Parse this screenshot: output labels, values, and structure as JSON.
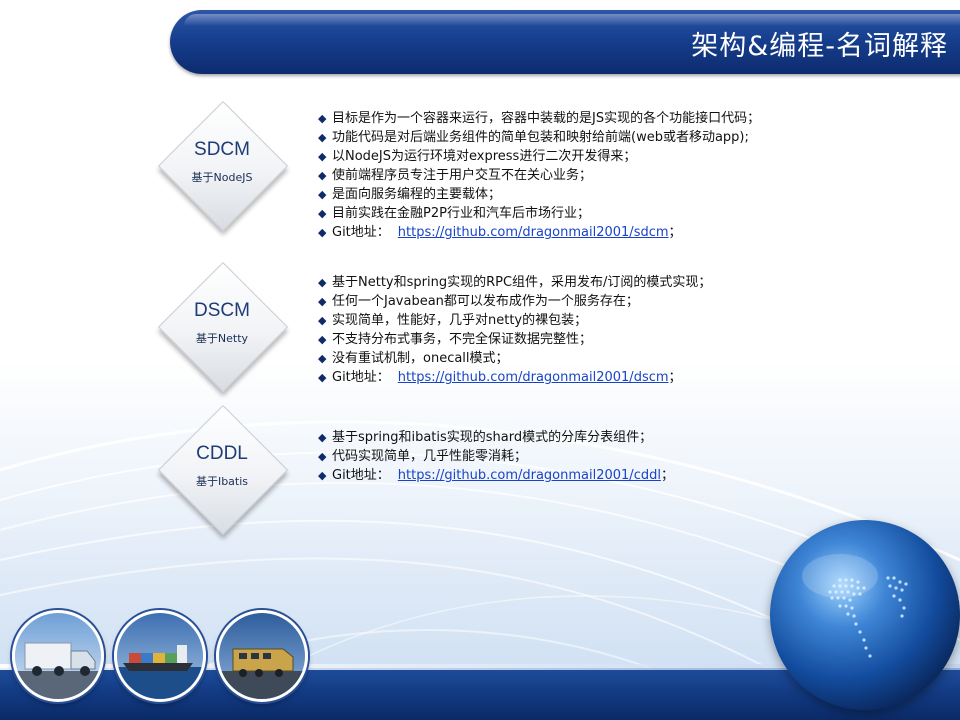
{
  "title": "架构&编程-名词解释",
  "sections": [
    {
      "name": "SDCM",
      "sub": "基于NodeJS",
      "bullets": [
        "目标是作为一个容器来运行，容器中装载的是JS实现的各个功能接口代码；",
        "功能代码是对后端业务组件的简单包装和映射给前端(web或者移动app);",
        "以NodeJS为运行环境对express进行二次开发得来；",
        "使前端程序员专注于用户交互不在关心业务；",
        "是面向服务编程的主要载体；",
        "目前实践在金融P2P行业和汽车后市场行业；"
      ],
      "git_label": "Git地址：",
      "git_url": "https://github.com/dragonmail2001/sdcm",
      "git_suffix": "；"
    },
    {
      "name": "DSCM",
      "sub": "基于Netty",
      "bullets": [
        "基于Netty和spring实现的RPC组件，采用发布/订阅的模式实现；",
        "任何一个Javabean都可以发布成作为一个服务存在；",
        "实现简单，性能好，几乎对netty的裸包装；",
        "不支持分布式事务，不完全保证数据完整性；",
        "没有重试机制，onecall模式；"
      ],
      "git_label": "Git地址：",
      "git_url": "https://github.com/dragonmail2001/dscm",
      "git_suffix": "；"
    },
    {
      "name": "CDDL",
      "sub": "基于Ibatis",
      "bullets": [
        "基于spring和ibatis实现的shard模式的分库分表组件；",
        "代码实现简单，几乎性能零消耗；"
      ],
      "git_label": "Git地址：",
      "git_url": "https://github.com/dragonmail2001/cddl",
      "git_suffix": "；"
    }
  ],
  "bullet_glyph": "◆",
  "colors": {
    "title_bar": "#163f8e",
    "diamond_text": "#1f3c74",
    "link": "#1a44c7",
    "bottom_band": "#123a82"
  },
  "icons": [
    "truck-photo",
    "ship-photo",
    "train-photo",
    "globe-graphic"
  ]
}
